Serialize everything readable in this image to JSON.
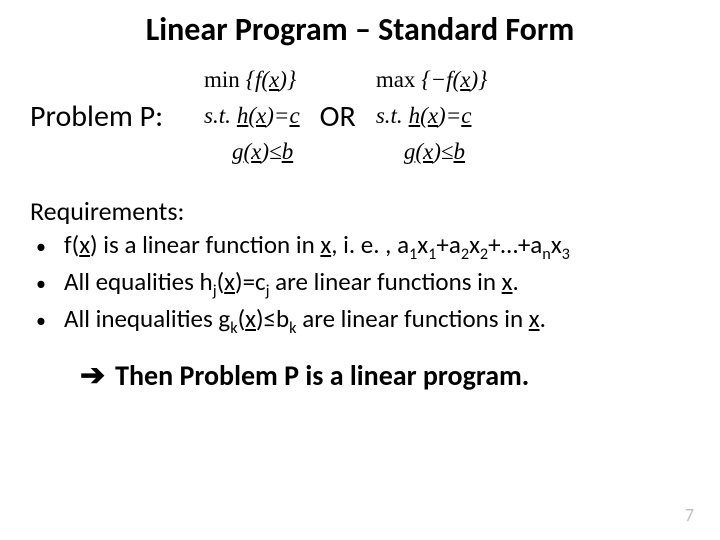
{
  "title": "Linear Program – Standard Form",
  "problem_label": "Problem P:",
  "or_label": "OR",
  "math": {
    "min_label": "min",
    "max_label": "max",
    "st_label": "s.t.",
    "f_expr_open": "{",
    "f_expr_close": "}",
    "f_x": "f",
    "neg": "−",
    "x": "x",
    "h_x": "h",
    "g_x": "g",
    "eq": "=",
    "leq": "≤",
    "c": "c",
    "b": "b",
    "lparen": "(",
    "rparen": ")"
  },
  "requirements_heading": "Requirements:",
  "req1_pre": "f(",
  "req1_mid": ") is a linear function in ",
  "req1_post": ", i. e. , a",
  "req1_tail": "+…+a",
  "req2_pre": "All equalities h",
  "req2_mid": ")=c",
  "req2_post": " are linear functions in ",
  "req3_pre": "All inequalities g",
  "req3_mid": ")≤b",
  "req3_post": " are linear functions in ",
  "x_var": "x",
  "subs": {
    "one": "1",
    "two": "2",
    "three": "3",
    "j": "j",
    "k": "k",
    "n": "n"
  },
  "plus": "+",
  "a": "a",
  "period": ".",
  "lparen": "(",
  "conclusion": "Then  Problem P is a linear program.",
  "page_number": "7"
}
